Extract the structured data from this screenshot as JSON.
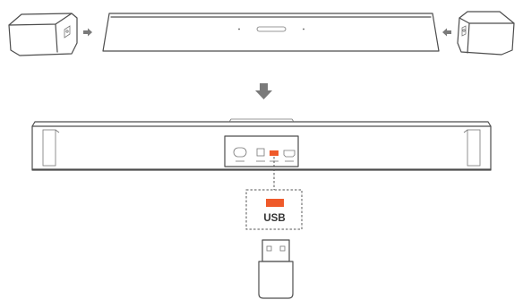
{
  "callout": {
    "label": "USB",
    "highlight_color": "#ef5a2a"
  },
  "colors": {
    "line": "#4d4d4d",
    "arrow": "#7a7a7a",
    "usb_port": "#ef5a2a"
  },
  "icons": [
    "speaker-module-icon",
    "soundbar-icon",
    "arrow-right-icon",
    "arrow-left-icon",
    "arrow-down-icon",
    "usb-drive-icon"
  ]
}
